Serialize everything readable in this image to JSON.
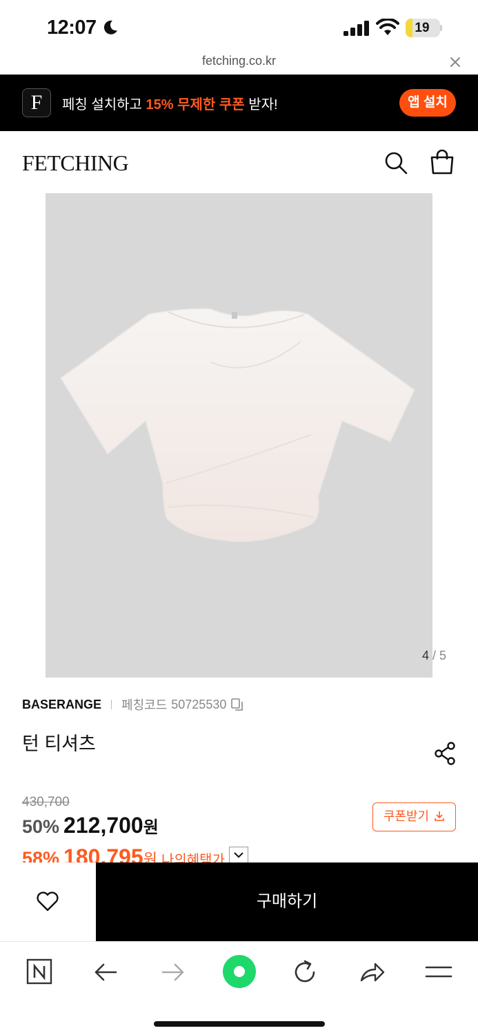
{
  "status_bar": {
    "time": "12:07",
    "battery": "19",
    "battery_level": 0.19,
    "icons": [
      "moon-icon",
      "cellular-signal-icon",
      "wifi-icon",
      "battery-icon"
    ]
  },
  "browser": {
    "url": "fetching.co.kr",
    "toolbar": [
      "naver-icon",
      "back-arrow-icon",
      "forward-arrow-icon",
      "green-dot-icon",
      "refresh-icon",
      "share-arrow-icon",
      "menu-icon"
    ]
  },
  "promo": {
    "logo_letter": "F",
    "text_before": "페칭 설치하고 ",
    "text_accent": "15% 무제한 쿠폰",
    "text_after": " 받자!",
    "install_label": "앱 설치"
  },
  "header": {
    "logo": "FETCHING"
  },
  "gallery": {
    "current": "4",
    "divider": " / ",
    "total": "5"
  },
  "product": {
    "brand": "BASERANGE",
    "code_label": "페칭코드",
    "code": "50725530",
    "title": "턴 티셔츠",
    "original_price": "430,700",
    "sale_percent": "50%",
    "sale_price": "212,700",
    "currency": "원",
    "benefit_percent": "58%",
    "benefit_price": "180,795",
    "benefit_label": "나의혜택가",
    "coupon_label": "쿠폰받기"
  },
  "actions": {
    "buy_label": "구매하기"
  },
  "colors": {
    "accent": "#ff5a1f",
    "banner_bg": "#000000",
    "image_bg": "#d8d8d8",
    "toolbar_green": "#1ed86b"
  }
}
